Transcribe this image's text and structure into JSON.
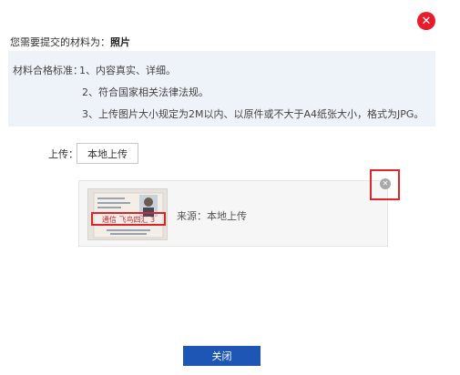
{
  "dialog": {
    "close_icon_glyph": "✕",
    "accent_color": "#e81c2b"
  },
  "material": {
    "prefix": "您需要提交的材料为：",
    "name": "照片"
  },
  "criteria": {
    "label": "材料合格标准：",
    "items": [
      "1、内容真实、详细。",
      "2、符合国家相关法律法规。",
      "3、上传图片大小规定为2M以内、以原件或不大于A4纸张大小，格式为JPG。"
    ]
  },
  "upload": {
    "label": "上传：",
    "button_label": "本地上传"
  },
  "file": {
    "source_text": "来源：本地上传",
    "thumbnail_stamp_text": "通信 飞鸟四汇 3",
    "remove_icon_glyph": "✕"
  },
  "footer": {
    "close_label": "关闭",
    "button_color": "#1e56b5"
  }
}
